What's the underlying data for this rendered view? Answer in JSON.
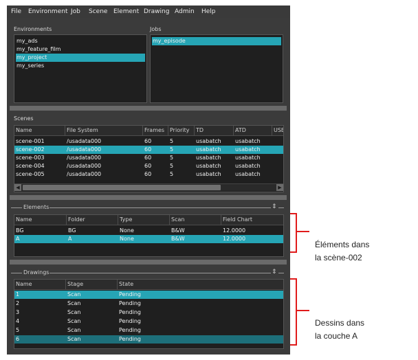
{
  "menu": [
    "File",
    "Environment",
    "Job",
    "Scene",
    "Element",
    "Drawing",
    "Admin",
    "Help"
  ],
  "environments": {
    "label": "Environments",
    "items": [
      "my_ads",
      "my_feature_film",
      "my_project",
      "my_series"
    ],
    "selected_index": 2
  },
  "jobs": {
    "label": "Jobs",
    "items": [
      "my_episode"
    ],
    "selected_index": 0
  },
  "scenes": {
    "label": "Scenes",
    "columns": [
      "Name",
      "File System",
      "Frames",
      "Priority",
      "TD",
      "ATD",
      "USE"
    ],
    "rows": [
      [
        "scene-001",
        "/usadata000",
        "60",
        "5",
        "usabatch",
        "usabatch"
      ],
      [
        "scene-002",
        "/usadata000",
        "60",
        "5",
        "usabatch",
        "usabatch"
      ],
      [
        "scene-003",
        "/usadata000",
        "60",
        "5",
        "usabatch",
        "usabatch"
      ],
      [
        "scene-004",
        "/usadata000",
        "60",
        "5",
        "usabatch",
        "usabatch"
      ],
      [
        "scene-005",
        "/usadata000",
        "60",
        "5",
        "usabatch",
        "usabatch"
      ]
    ],
    "selected_index": 1
  },
  "elements": {
    "label": "Elements",
    "columns": [
      "Name",
      "Folder",
      "Type",
      "Scan",
      "Field Chart"
    ],
    "rows": [
      [
        "BG",
        "BG",
        "None",
        "B&W",
        "12.0000"
      ],
      [
        "A",
        "A",
        "None",
        "B&W",
        "12.0000"
      ]
    ],
    "selected_index": 1
  },
  "drawings": {
    "label": "Drawings",
    "columns": [
      "Name",
      "Stage",
      "State"
    ],
    "rows": [
      [
        "1",
        "Scan",
        "Pending"
      ],
      [
        "2",
        "Scan",
        "Pending"
      ],
      [
        "3",
        "Scan",
        "Pending"
      ],
      [
        "4",
        "Scan",
        "Pending"
      ],
      [
        "5",
        "Scan",
        "Pending"
      ],
      [
        "6",
        "Scan",
        "Pending"
      ]
    ],
    "selected_index": 0,
    "secondary_selected_index": 5
  },
  "annotations": {
    "elements_note_line1": "Éléments dans",
    "elements_note_line2": "la scène-002",
    "drawings_note_line1": "Dessins dans",
    "drawings_note_line2": "la couche A"
  },
  "colors": {
    "selection": "#26a5b5",
    "highlight": "#e01a1a",
    "panel": "#3b3b3b"
  }
}
